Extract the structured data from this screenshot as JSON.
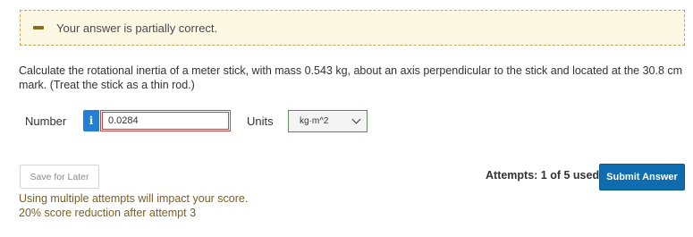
{
  "feedback": {
    "status_text": "Your answer is partially correct.",
    "icon": "minus-icon",
    "background": "#fdf8e4",
    "border_color": "#c8a45a"
  },
  "question": {
    "text": "Calculate the rotational inertia of a meter stick, with mass 0.543 kg, about an axis perpendicular to the stick and located at the 30.8 cm mark. (Treat the stick as a thin rod.)"
  },
  "answer": {
    "number_label": "Number",
    "info_icon_glyph": "i",
    "value": "0.0284",
    "units_label": "Units",
    "units_selected": "kg·m^2",
    "input_border_color": "#b94a48"
  },
  "actions": {
    "save_label": "Save for Later",
    "attempts_text": "Attempts: 1 of 5 used",
    "submit_label": "Submit Answer",
    "submit_color": "#0f6cae"
  },
  "penalty": {
    "line1": "Using multiple attempts will impact your score.",
    "line2": "20% score reduction after attempt 3"
  }
}
